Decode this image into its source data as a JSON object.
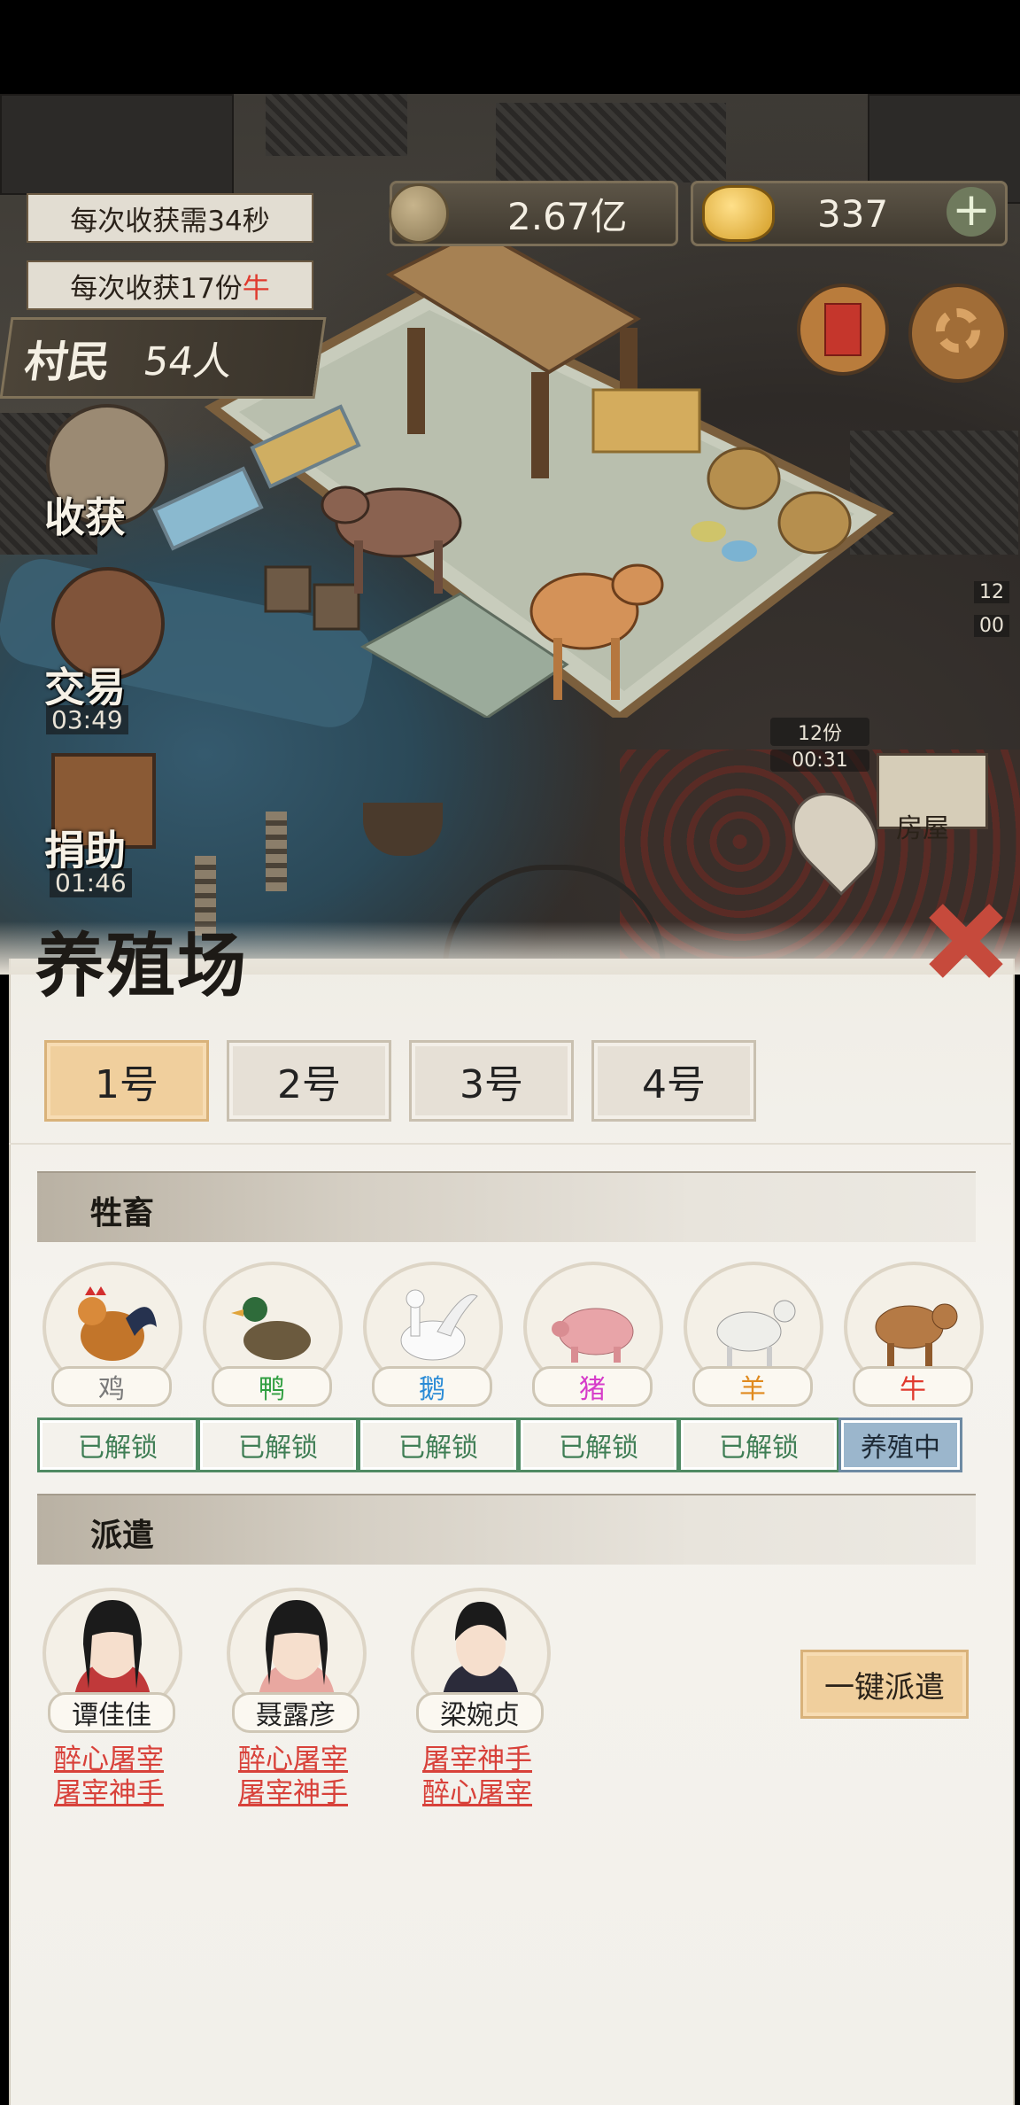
{
  "hud": {
    "harvest_time": "每次收获需34秒",
    "harvest_amount_prefix": "每次收获17份",
    "harvest_amount_item": "牛",
    "villagers_label": "村民",
    "villagers_count": "54人",
    "coins": "2.67亿",
    "gold": "337",
    "add_icon": "plus-icon"
  },
  "side_buttons": [
    {
      "label": "收获",
      "icon": "official-portrait-icon"
    },
    {
      "label": "交易",
      "icon": "scale-icon",
      "timer": "03:49"
    },
    {
      "label": "捐助",
      "icon": "donation-icon",
      "timer": "01:46"
    }
  ],
  "map_labels": {
    "share_count": "12份",
    "share_timer": "00:31",
    "house": "房屋",
    "edge_label_1": "12",
    "edge_label_2": "00"
  },
  "panel": {
    "title": "养殖场",
    "tabs": [
      {
        "label": "1号",
        "active": true
      },
      {
        "label": "2号",
        "active": false
      },
      {
        "label": "3号",
        "active": false
      },
      {
        "label": "4号",
        "active": false
      }
    ],
    "livestock_title": "牲畜",
    "animals": [
      {
        "name": "鸡",
        "color": "#7a7a7a",
        "status": "已解锁",
        "icon": "rooster-icon"
      },
      {
        "name": "鸭",
        "color": "#2f9e3f",
        "status": "已解锁",
        "icon": "duck-icon"
      },
      {
        "name": "鹅",
        "color": "#2a8bd6",
        "status": "已解锁",
        "icon": "goose-icon"
      },
      {
        "name": "猪",
        "color": "#d63cc9",
        "status": "已解锁",
        "icon": "pig-icon"
      },
      {
        "name": "羊",
        "color": "#e08a1e",
        "status": "已解锁",
        "icon": "goat-icon"
      },
      {
        "name": "牛",
        "color": "#e03a2e",
        "status": "养殖中",
        "icon": "ox-icon"
      }
    ],
    "dispatch_title": "派遣",
    "workers": [
      {
        "name": "谭佳佳",
        "skills": [
          "醉心屠宰",
          "屠宰神手"
        ]
      },
      {
        "name": "聂露彦",
        "skills": [
          "醉心屠宰",
          "屠宰神手"
        ]
      },
      {
        "name": "梁婉贞",
        "skills": [
          "屠宰神手",
          "醉心屠宰"
        ]
      }
    ],
    "dispatch_all": "一键派遣"
  }
}
